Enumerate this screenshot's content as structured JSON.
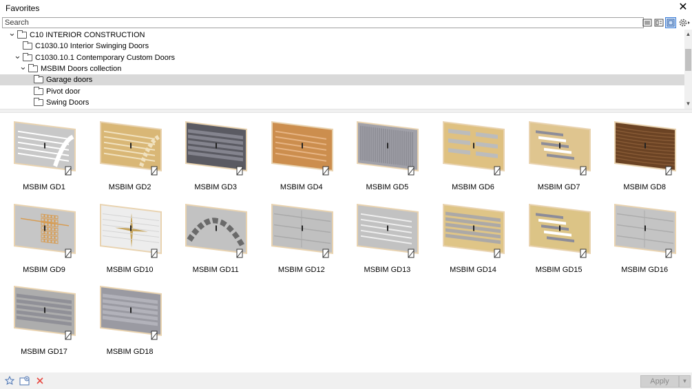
{
  "window": {
    "title": "Favorites",
    "close_label": "✕"
  },
  "search": {
    "placeholder": "Search"
  },
  "tree": [
    {
      "label": "C10 INTERIOR CONSTRUCTION",
      "level": 0,
      "expanded": true,
      "selected": false
    },
    {
      "label": "C1030.10 Interior Swinging Doors",
      "level": 1,
      "expanded": false,
      "selected": false
    },
    {
      "label": "C1030.10.1 Contemporary Custom Doors",
      "level": 1,
      "expanded": true,
      "selected": false
    },
    {
      "label": "MSBIM Doors collection",
      "level": 2,
      "expanded": true,
      "selected": false
    },
    {
      "label": "Garage doors",
      "level": 3,
      "expanded": false,
      "selected": true
    },
    {
      "label": "Pivot door",
      "level": 3,
      "expanded": false,
      "selected": false
    },
    {
      "label": "Swing Doors",
      "level": 3,
      "expanded": false,
      "selected": false
    }
  ],
  "items": [
    {
      "label": "MSBIM GD1",
      "base": "#c8c8c8",
      "accent": "#ffffff",
      "style": "lines-arc"
    },
    {
      "label": "MSBIM GD2",
      "base": "#d9b776",
      "accent": "#f1e2c0",
      "style": "lines-arc"
    },
    {
      "label": "MSBIM GD3",
      "base": "#5a5a62",
      "accent": "#8c8c96",
      "style": "bands"
    },
    {
      "label": "MSBIM GD4",
      "base": "#cc8e4e",
      "accent": "#e7b585",
      "style": "lines"
    },
    {
      "label": "MSBIM GD5",
      "base": "#a1a1a9",
      "accent": "#7e7e86",
      "style": "mesh"
    },
    {
      "label": "MSBIM GD6",
      "base": "#dfc181",
      "accent": "#bcbcbc",
      "style": "panels"
    },
    {
      "label": "MSBIM GD7",
      "base": "#dfc58f",
      "accent": "#8d8d99",
      "style": "mixed"
    },
    {
      "label": "MSBIM GD8",
      "base": "#6b4324",
      "accent": "#875a35",
      "style": "wood"
    },
    {
      "label": "MSBIM GD9",
      "base": "#c6c6c6",
      "accent": "#d79c52",
      "style": "grid"
    },
    {
      "label": "MSBIM GD10",
      "base": "#ededed",
      "accent": "#c6a45c",
      "style": "star"
    },
    {
      "label": "MSBIM GD11",
      "base": "#c2c2c2",
      "accent": "#6a6a6a",
      "style": "arc"
    },
    {
      "label": "MSBIM GD12",
      "base": "#c0c0c0",
      "accent": "#a9a9a9",
      "style": "plain"
    },
    {
      "label": "MSBIM GD13",
      "base": "#c2c2c2",
      "accent": "#eeeeee",
      "style": "lines"
    },
    {
      "label": "MSBIM GD14",
      "base": "#dfc587",
      "accent": "#a3a3ad",
      "style": "bands"
    },
    {
      "label": "MSBIM GD15",
      "base": "#dcc486",
      "accent": "#8c8c99",
      "style": "mixed"
    },
    {
      "label": "MSBIM GD16",
      "base": "#c4c4c4",
      "accent": "#acacac",
      "style": "plain"
    },
    {
      "label": "MSBIM GD17",
      "base": "#adadad",
      "accent": "#8b8b93",
      "style": "bands"
    },
    {
      "label": "MSBIM GD18",
      "base": "#9a9aa2",
      "accent": "#b6b6be",
      "style": "bands"
    }
  ],
  "toolbar": {
    "apply_label": "Apply"
  },
  "colors": {
    "selected_row": "#d9d9d9",
    "panel_bg": "#f0f0f0",
    "frame_edge": "#e9d3b0",
    "delete_icon": "#e8463f"
  }
}
